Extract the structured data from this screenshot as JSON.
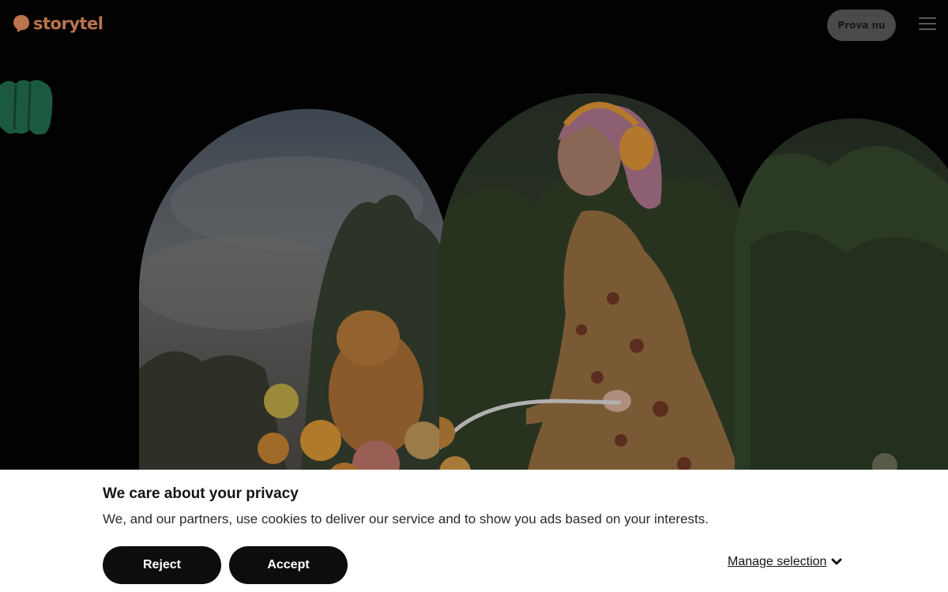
{
  "header": {
    "logo_text": "storytel",
    "try_button": "Prova nu",
    "menu_icon": "hamburger-menu-icon"
  },
  "colors": {
    "brand": "#b9744e",
    "deco_green": "#1c5a40",
    "banner_bg": "#ffffff",
    "button_bg": "#0d0d0d"
  },
  "hero": {
    "image_description_icons": [
      "woman-on-bicycle-image",
      "cat-image",
      "flower-basket-image"
    ]
  },
  "cookie_banner": {
    "title": "We care about your privacy",
    "text": "We, and our partners, use cookies to deliver our service and to show you ads based on your interests.",
    "reject_label": "Reject",
    "accept_label": "Accept",
    "manage_label": "Manage selection"
  }
}
